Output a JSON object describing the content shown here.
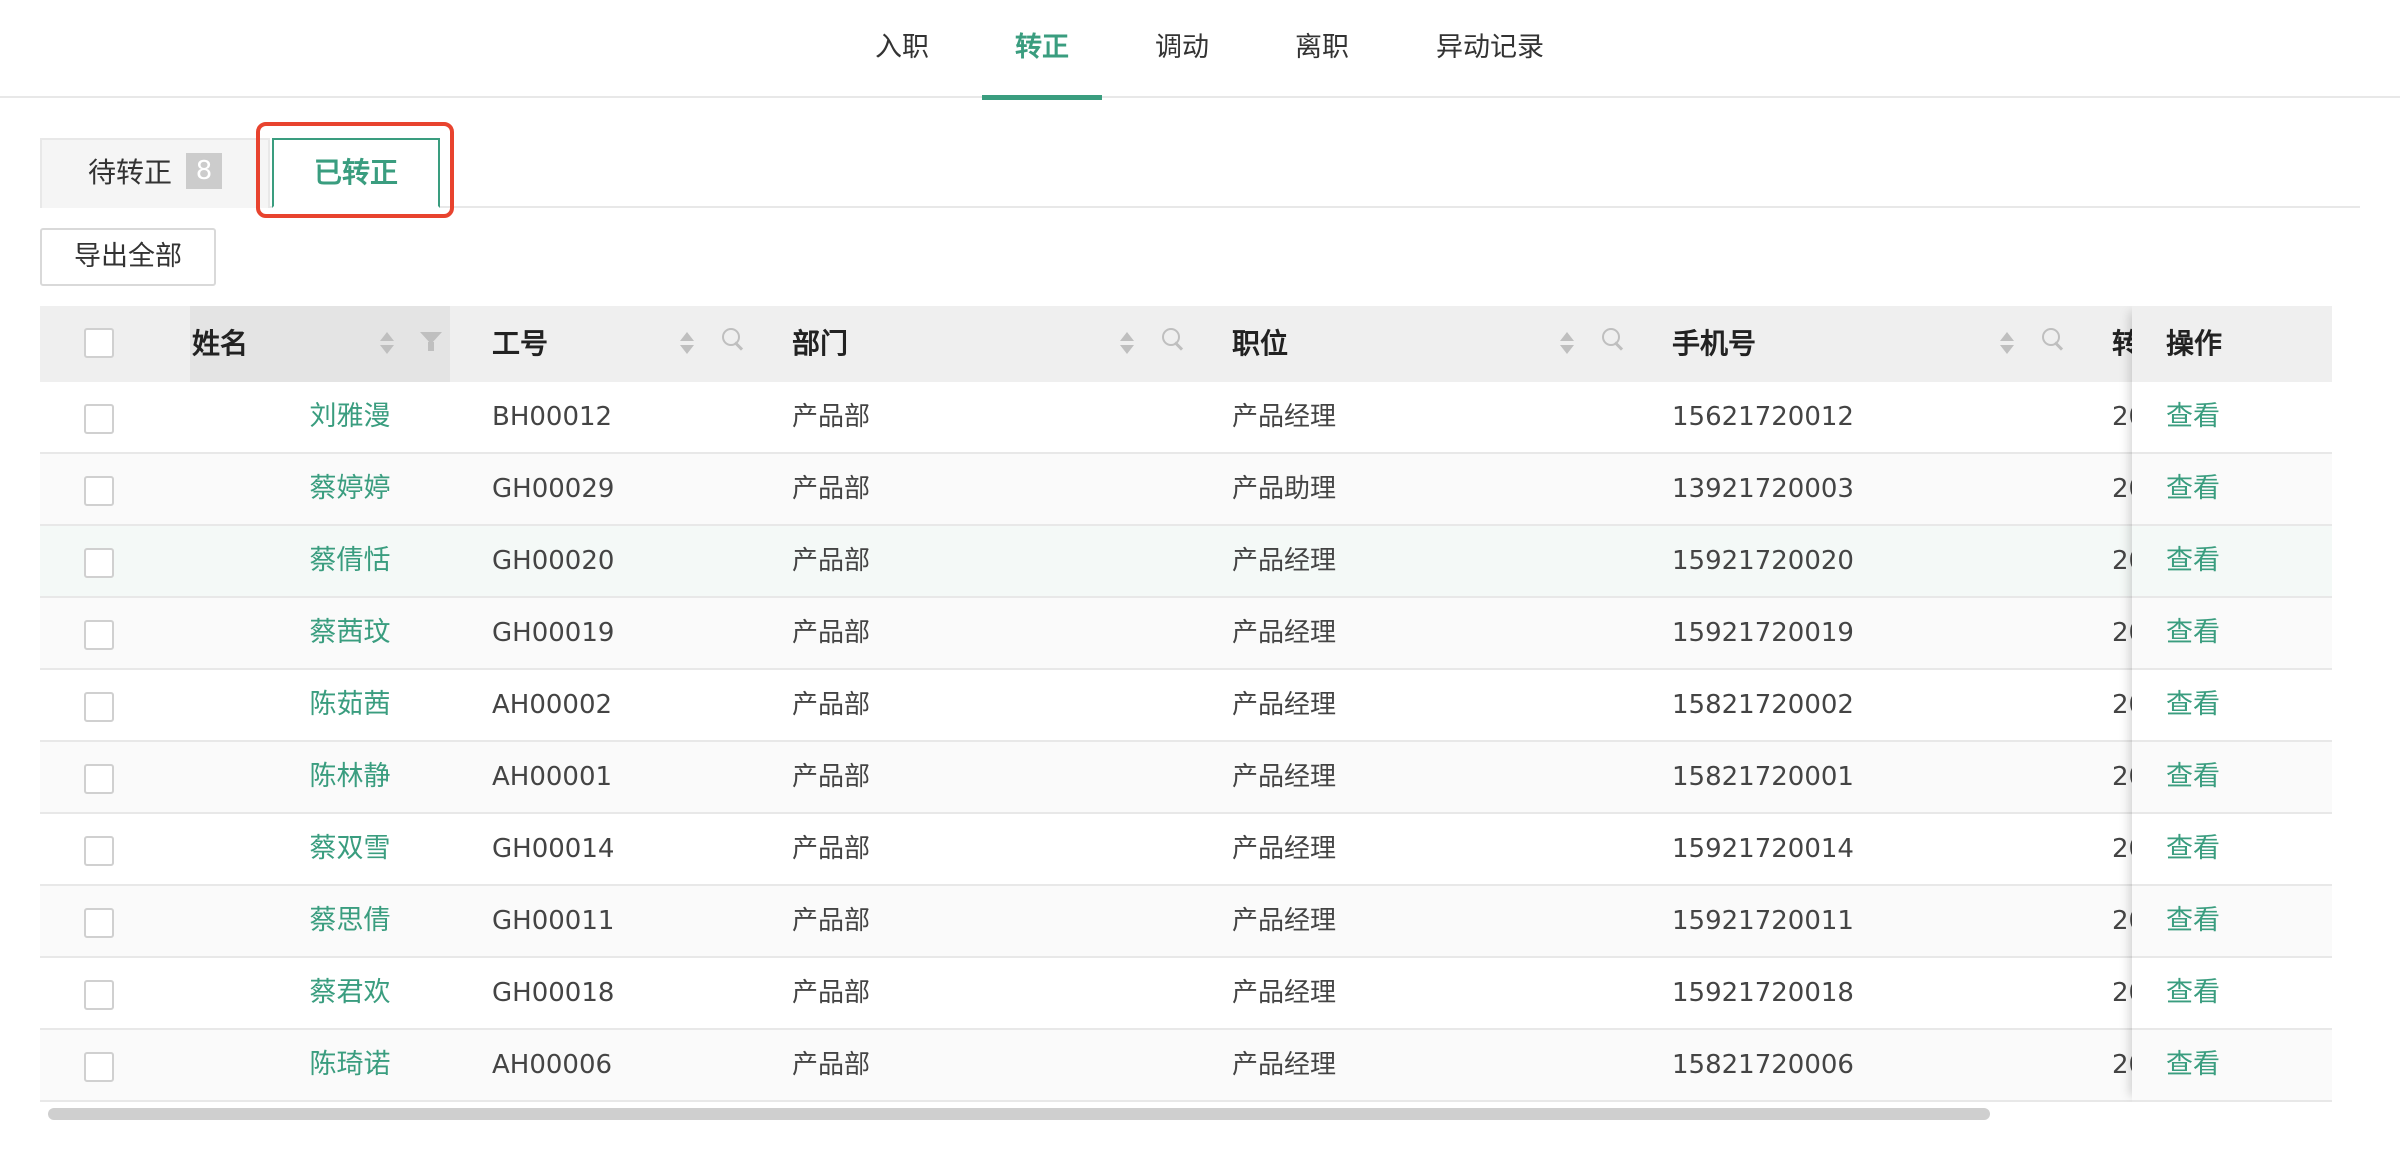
{
  "topnav": {
    "items": [
      {
        "label": "入职"
      },
      {
        "label": "转正"
      },
      {
        "label": "调动"
      },
      {
        "label": "离职"
      },
      {
        "label": "异动记录"
      }
    ],
    "active": "转正"
  },
  "subtabs": {
    "pending_label": "待转正",
    "pending_count": "8",
    "done_label": "已转正"
  },
  "toolbar": {
    "export_label": "导出全部"
  },
  "table": {
    "columns": {
      "name": "姓名",
      "id": "工号",
      "dept": "部门",
      "position": "职位",
      "phone": "手机号",
      "date_partial": "转",
      "action": "操作"
    },
    "rows": [
      {
        "name": "刘雅漫",
        "id": "BH00012",
        "dept": "产品部",
        "position": "产品经理",
        "phone": "15621720012",
        "date_partial": "20",
        "action": "查看"
      },
      {
        "name": "蔡婷婷",
        "id": "GH00029",
        "dept": "产品部",
        "position": "产品助理",
        "phone": "13921720003",
        "date_partial": "20",
        "action": "查看"
      },
      {
        "name": "蔡倩恬",
        "id": "GH00020",
        "dept": "产品部",
        "position": "产品经理",
        "phone": "15921720020",
        "date_partial": "20",
        "action": "查看"
      },
      {
        "name": "蔡茜玟",
        "id": "GH00019",
        "dept": "产品部",
        "position": "产品经理",
        "phone": "15921720019",
        "date_partial": "20",
        "action": "查看"
      },
      {
        "name": "陈茹茜",
        "id": "AH00002",
        "dept": "产品部",
        "position": "产品经理",
        "phone": "15821720002",
        "date_partial": "20",
        "action": "查看"
      },
      {
        "name": "陈林静",
        "id": "AH00001",
        "dept": "产品部",
        "position": "产品经理",
        "phone": "15821720001",
        "date_partial": "20",
        "action": "查看"
      },
      {
        "name": "蔡双雪",
        "id": "GH00014",
        "dept": "产品部",
        "position": "产品经理",
        "phone": "15921720014",
        "date_partial": "20",
        "action": "查看"
      },
      {
        "name": "蔡思倩",
        "id": "GH00011",
        "dept": "产品部",
        "position": "产品经理",
        "phone": "15921720011",
        "date_partial": "20",
        "action": "查看"
      },
      {
        "name": "蔡君欢",
        "id": "GH00018",
        "dept": "产品部",
        "position": "产品经理",
        "phone": "15921720018",
        "date_partial": "20",
        "action": "查看"
      },
      {
        "name": "陈琦诺",
        "id": "AH00006",
        "dept": "产品部",
        "position": "产品经理",
        "phone": "15821720006",
        "date_partial": "20",
        "action": "查看"
      }
    ]
  },
  "colors": {
    "accent": "#3a9d7f",
    "highlight": "#e8432e"
  }
}
